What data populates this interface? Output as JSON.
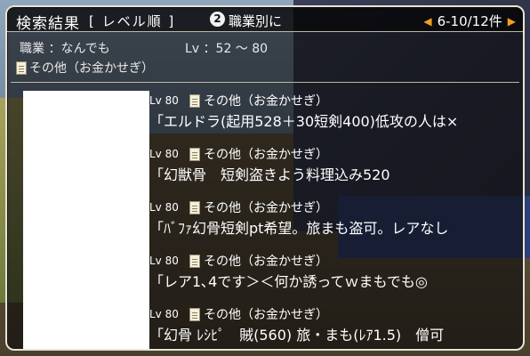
{
  "header": {
    "title": "検索結果",
    "sort_mode": "[ レベル順 ]",
    "switch_button_number": "2",
    "switch_button_label": "職業別に",
    "page_range": "6-10/12件"
  },
  "filter": {
    "job": "職業 ：なんでも",
    "level_range": "Lv ：52 ～ 80",
    "category": "その他（お金かせぎ）"
  },
  "results": [
    {
      "level": "Lv 80",
      "category": "その他（お金かせぎ）",
      "message": "「エルドラ(起用528＋30短剣400)低攻の人は×"
    },
    {
      "level": "Lv 80",
      "category": "その他（お金かせぎ）",
      "message": "「幻獣骨　短剣盗きよう料理込み520"
    },
    {
      "level": "Lv 80",
      "category": "その他（お金かせぎ）",
      "message": "「ﾊﾞﾌｧ幻骨短剣pt希望。旅まも盗可。レアなし"
    },
    {
      "level": "Lv 80",
      "category": "その他（お金かせぎ）",
      "message": "「レア1､4です＞＜何か誘ってｗまもでも◎"
    },
    {
      "level": "Lv 80",
      "category": "その他（お金かせぎ）",
      "message": "「幻骨 ﾚｼﾋﾟ　賊(560) 旅・まも(ﾚｱ1.5)　僧可"
    }
  ],
  "icons": {
    "page_prev": "triangle-left-icon",
    "page_next": "triangle-right-icon",
    "category": "document-icon"
  },
  "colors": {
    "panel_border": "#e7e3d6",
    "arrow": "#f0a020",
    "button_bg": "#f2f2f2"
  }
}
